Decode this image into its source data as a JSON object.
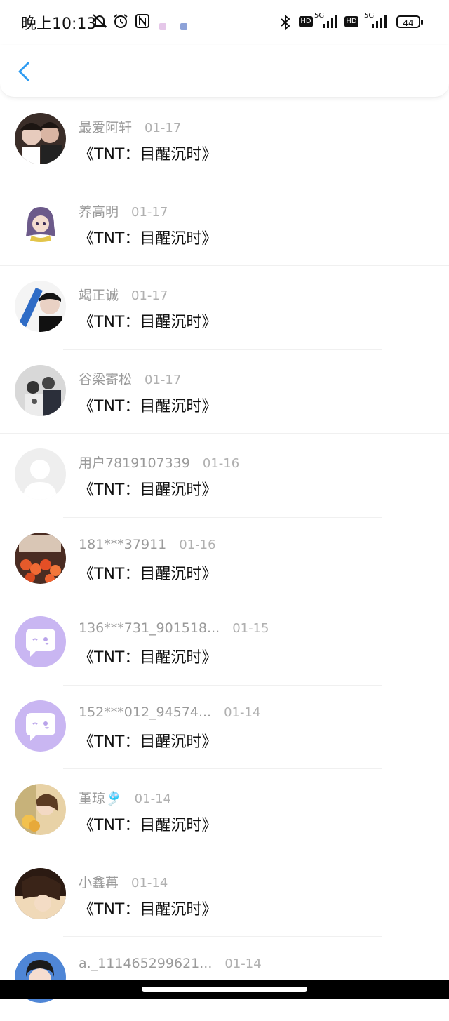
{
  "status_bar": {
    "time": "晚上10:13",
    "battery": "44",
    "network_1": "5G",
    "network_2": "5G",
    "hd_1": "HD",
    "hd_2": "HD"
  },
  "nav": {
    "back_icon": "chevron-left-icon"
  },
  "items": [
    {
      "name": "最爱阿轩",
      "date": "01-17",
      "content": "《TNT：目醒沉时》",
      "avatar": "photo-couple"
    },
    {
      "name": "养高明",
      "date": "01-17",
      "content": "《TNT：目醒沉时》",
      "avatar": "anime-girl"
    },
    {
      "name": "竭正诚",
      "date": "01-17",
      "content": "《TNT：目醒沉时》",
      "avatar": "photo-person"
    },
    {
      "name": "谷梁寄松",
      "date": "01-17",
      "content": "《TNT：目醒沉时》",
      "avatar": "photo-group"
    },
    {
      "name": "用户7819107339",
      "date": "01-16",
      "content": "《TNT：目醒沉时》",
      "avatar": "default-gray"
    },
    {
      "name": "181***37911",
      "date": "01-16",
      "content": "《TNT：目醒沉时》",
      "avatar": "photo-flowers"
    },
    {
      "name": "136***731_901518...",
      "date": "01-15",
      "content": "《TNT：目醒沉时》",
      "avatar": "default-purple"
    },
    {
      "name": "152***012_94574...",
      "date": "01-14",
      "content": "《TNT：目醒沉时》",
      "avatar": "default-purple"
    },
    {
      "name": "堇琼🎐",
      "date": "01-14",
      "content": "《TNT：目醒沉时》",
      "avatar": "photo-girl"
    },
    {
      "name": "小鑫苒",
      "date": "01-14",
      "content": "《TNT：目醒沉时》",
      "avatar": "photo-portrait"
    },
    {
      "name": "a._111465299621...",
      "date": "01-14",
      "content": "",
      "avatar": "photo-girl-blue"
    }
  ]
}
